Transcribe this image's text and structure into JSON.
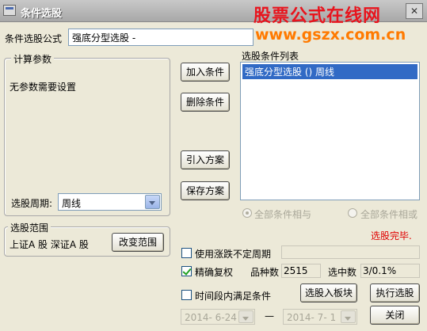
{
  "window": {
    "title": "条件选股",
    "close_glyph": "✕"
  },
  "watermark": {
    "line1": "股票公式在线网",
    "line2": "www.gszx.com.cn"
  },
  "formula": {
    "label": "条件选股公式",
    "value": "强底分型选股 -"
  },
  "params_group": {
    "title": "计算参数",
    "message": "无参数需要设置"
  },
  "period": {
    "label": "选股周期:",
    "value": "周线"
  },
  "buttons": {
    "add_condition": "加入条件",
    "delete_condition": "删除条件",
    "import_plan": "引入方案",
    "save_plan": "保存方案",
    "change_range": "改变范围",
    "select_to_block": "选股入板块",
    "execute": "执行选股",
    "close": "关闭"
  },
  "condition_list": {
    "label": "选股条件列表",
    "items": [
      "强底分型选股 () 周线"
    ]
  },
  "logic": {
    "all_and": "全部条件相与",
    "all_or": "全部条件相或"
  },
  "status": {
    "text": "选股完毕."
  },
  "range_group": {
    "title": "选股范围",
    "value": "上证A 股 深证A 股"
  },
  "options": {
    "use_uncertain_period": "使用涨跌不定周期",
    "precise_adjust": "精确复权",
    "time_period_condition": "时间段内满足条件"
  },
  "stats": {
    "count_label": "品种数",
    "count_value": "2515",
    "selected_label": "选中数",
    "selected_value": "3/0.1%"
  },
  "dates": {
    "start": "2014- 6-24",
    "separator": "—",
    "end": "2014- 7- 1"
  },
  "colors": {
    "selection": "#316ac5",
    "status": "#e00000",
    "watermark_red": "#e8141d",
    "watermark_orange": "#ff7a00"
  }
}
